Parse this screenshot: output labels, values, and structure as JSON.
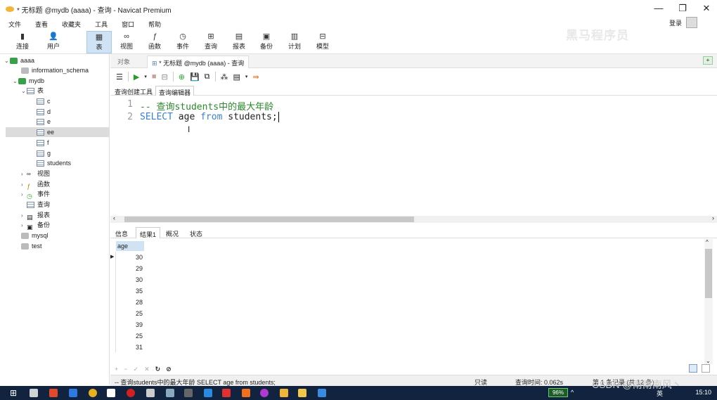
{
  "window": {
    "title": "* 无标题 @mydb (aaaa) - 查询 - Navicat Premium",
    "login": "登录"
  },
  "menu": [
    "文件",
    "查看",
    "收藏夹",
    "工具",
    "窗口",
    "帮助"
  ],
  "toolbar": {
    "buttons": [
      {
        "label": "连接",
        "icon": "connection-icon"
      },
      {
        "label": "用户",
        "icon": "user-icon"
      },
      {
        "label": "表",
        "icon": "table-icon"
      },
      {
        "label": "视图",
        "icon": "view-icon"
      },
      {
        "label": "函数",
        "icon": "function-icon"
      },
      {
        "label": "事件",
        "icon": "event-icon"
      },
      {
        "label": "查询",
        "icon": "query-icon"
      },
      {
        "label": "报表",
        "icon": "report-icon"
      },
      {
        "label": "备份",
        "icon": "backup-icon"
      },
      {
        "label": "计划",
        "icon": "schedule-icon"
      },
      {
        "label": "模型",
        "icon": "model-icon"
      }
    ],
    "watermark": "黑马程序员"
  },
  "sidebar": {
    "root": "aaaa",
    "schemas": [
      "information_schema",
      "mydb",
      "mysql",
      "test"
    ],
    "tables_group": "表",
    "tables": [
      "c",
      "d",
      "e",
      "ee",
      "f",
      "g",
      "students"
    ],
    "groups": [
      "视图",
      "函数",
      "事件",
      "查询",
      "报表",
      "备份"
    ]
  },
  "tabs": {
    "objects": "对象",
    "query": "* 无标题 @mydb (aaaa) - 查询"
  },
  "subtabs": [
    "查询创建工具",
    "查询编辑器"
  ],
  "editor": {
    "lines": [
      {
        "no": "1",
        "comment": "-- 查询students中的最大年龄"
      },
      {
        "no": "2",
        "kw1": "SELECT",
        "t1": " age ",
        "kw2": "from",
        "t2": " students;"
      }
    ]
  },
  "result_tabs": [
    "信息",
    "结果1",
    "概况",
    "状态"
  ],
  "grid": {
    "column": "age",
    "rows": [
      "30",
      "29",
      "30",
      "35",
      "28",
      "25",
      "39",
      "25",
      "31"
    ]
  },
  "status": {
    "sql": "-- 查询students中的最大年龄 SELECT age from students;",
    "readonly": "只读",
    "time": "查询时间: 0.062s",
    "records": "第 1 条记录 (共 12 条)"
  },
  "taskbar": {
    "battery": "96%",
    "ime": "英",
    "clock": "15:10",
    "csdn": "CSDN @南南南风丶"
  }
}
